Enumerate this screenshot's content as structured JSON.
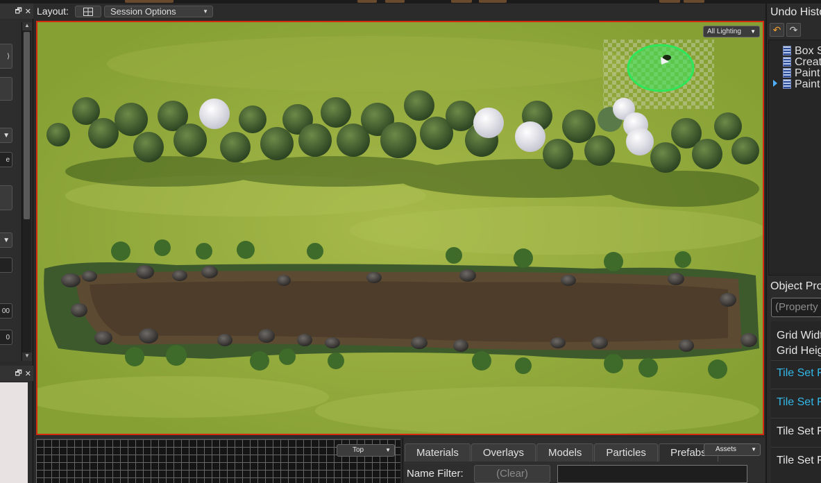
{
  "layout_bar": {
    "label": "Layout:",
    "session_options": "Session Options"
  },
  "viewport": {
    "lighting_dropdown": "All Lighting",
    "colors": {
      "frame": "#d42a10",
      "grass": "#8fa83a",
      "selection": "#2ee65a"
    }
  },
  "bottom_viewport": {
    "view_dropdown": "Top"
  },
  "assets_panel": {
    "tabs": [
      "Materials",
      "Overlays",
      "Models",
      "Particles",
      "Prefabs"
    ],
    "active_tab": "Prefabs",
    "dropdown": "Assets",
    "name_filter_label": "Name Filter:",
    "clear_button": "(Clear)",
    "name_filter_value": ""
  },
  "undo_history": {
    "title": "Undo History",
    "items": [
      "Box Select",
      "Create",
      "Paint",
      "Paint"
    ]
  },
  "object_properties": {
    "title": "Object Properties",
    "search_placeholder": "(Property Filter)",
    "rows": [
      {
        "label": "Grid Width",
        "style": "white"
      },
      {
        "label": "Grid Height",
        "style": "white"
      },
      {
        "label": "Tile Set Filter",
        "style": "cyan"
      },
      {
        "label": "Tile Set Filter",
        "style": "cyan"
      },
      {
        "label": "Tile Set Filter",
        "style": "white"
      },
      {
        "label": "Tile Set Filter",
        "style": "white"
      }
    ]
  },
  "left_panel": {
    "window_icons": [
      "restore-icon",
      "close-icon"
    ],
    "field_values": [
      "e",
      "00",
      "0"
    ]
  }
}
